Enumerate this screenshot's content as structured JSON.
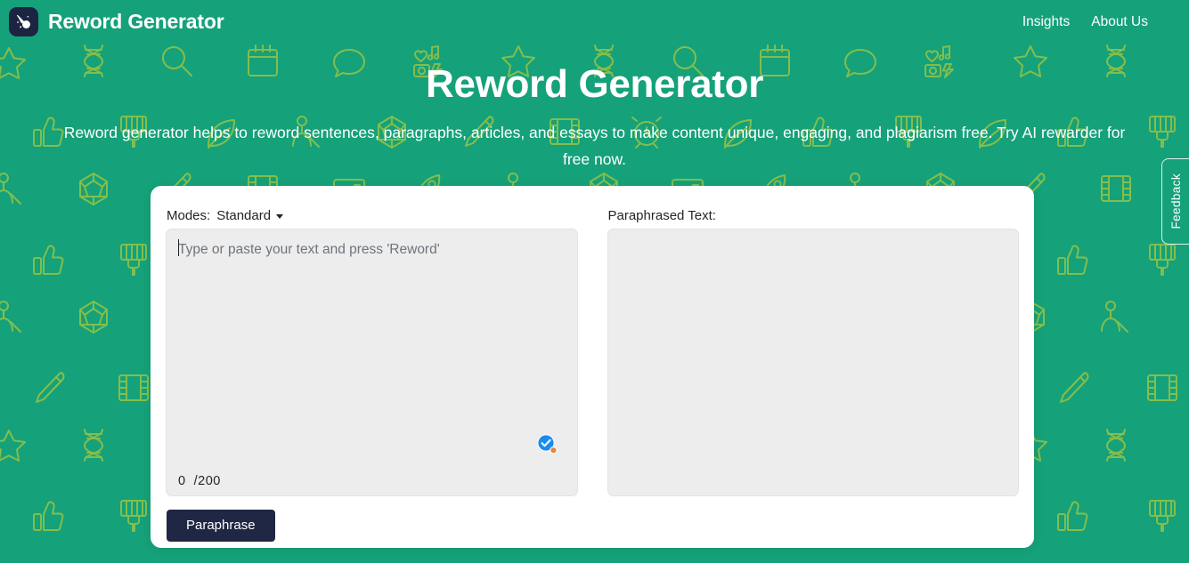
{
  "theme": {
    "brand_green": "#15a179",
    "pattern_icon_color": "#a8c93f",
    "dark_navy": "#1f2744",
    "logo_bg": "#1c2442",
    "input_bg": "#ededed",
    "card_bg": "#ffffff"
  },
  "header": {
    "logo_icon": "comet-icon",
    "brand_title": "Reword Generator",
    "nav": [
      {
        "label": "Insights"
      },
      {
        "label": "About Us"
      }
    ]
  },
  "hero": {
    "title": "Reword Generator",
    "subtitle": "Reword generator helps to reword sentences, paragraphs, articles, and essays to make content unique, engaging, and plagiarism free. Try AI rewarder for free now."
  },
  "tool": {
    "modes_label": "Modes:",
    "mode_selected": "Standard",
    "mode_options": [
      "Standard"
    ],
    "dropdown_icon": "chevron-down-icon",
    "input": {
      "placeholder": "Type or paste your text and press 'Reword'",
      "value": "",
      "char_count": "0",
      "char_limit": "/200",
      "assistant_badge_icon": "grammarly-check-icon"
    },
    "output": {
      "label": "Paraphrased Text:",
      "value": ""
    },
    "primary_button": "Paraphrase"
  },
  "feedback": {
    "label": "Feedback"
  },
  "background_pattern": {
    "icons": [
      "star-icon",
      "dna-icon",
      "search-icon",
      "calendar-icon",
      "chat-bubble-icon",
      "camera-music-icon",
      "thumbs-up-icon",
      "paint-brush-icon",
      "leaf-icon",
      "person-icon",
      "polyhedron-icon",
      "pen-icon",
      "film-strip-icon",
      "alarm-clock-icon",
      "card-icon",
      "rocket-icon"
    ]
  }
}
